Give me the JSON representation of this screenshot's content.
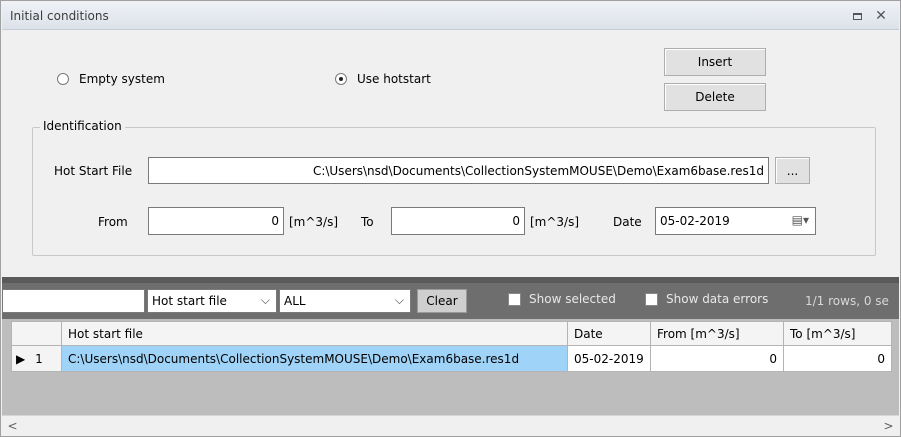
{
  "window": {
    "title": "Initial conditions"
  },
  "options": {
    "empty_system": "Empty system",
    "use_hotstart": "Use hotstart",
    "selected": "use_hotstart"
  },
  "buttons": {
    "insert": "Insert",
    "delete": "Delete",
    "browse": "..."
  },
  "identification": {
    "group_label": "Identification",
    "hot_start_file_label": "Hot Start File",
    "hot_start_file_value": "C:\\Users\\nsd\\Documents\\CollectionSystemMOUSE\\Demo\\Exam6base.res1d",
    "from_label": "From",
    "from_value": "0",
    "from_unit": "[m^3/s]",
    "to_label": "To",
    "to_value": "0",
    "to_unit": "[m^3/s]",
    "date_label": "Date",
    "date_value": "05-02-2019"
  },
  "filter": {
    "search_value": "",
    "column_select": "Hot start file",
    "value_select": "ALL",
    "clear": "Clear",
    "show_selected": "Show selected",
    "show_data_errors": "Show data errors",
    "row_info": "1/1 rows, 0 se"
  },
  "table": {
    "columns": [
      "",
      "Hot start file",
      "Date",
      "From [m^3/s]",
      "To [m^3/s]"
    ],
    "rows": [
      {
        "index": "1",
        "marker": "▶",
        "hot_start_file": "C:\\Users\\nsd\\Documents\\CollectionSystemMOUSE\\Demo\\Exam6base.res1d",
        "date": "05-02-2019",
        "from": "0",
        "to": "0"
      }
    ]
  },
  "colors": {
    "selection": "#9fd3f7",
    "filterbar": "#6e6e6e"
  }
}
